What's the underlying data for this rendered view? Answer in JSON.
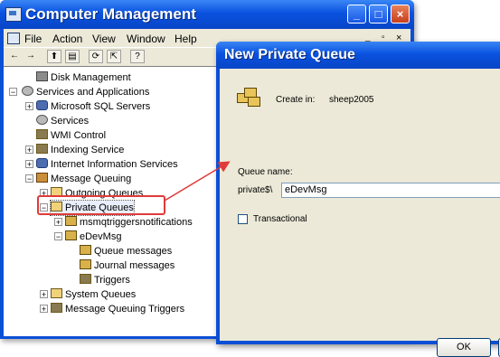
{
  "main_window": {
    "title": "Computer Management",
    "window_buttons": {
      "minimize": "_",
      "maximize": "□",
      "close": "×"
    },
    "menu": [
      "File",
      "Action",
      "View",
      "Window",
      "Help"
    ],
    "mdi_buttons": {
      "minimize": "_",
      "restore": "▫",
      "close": "×"
    },
    "toolbar_icons": [
      "back-icon",
      "forward-icon",
      "up-icon",
      "properties-icon",
      "refresh-icon",
      "export-icon",
      "help-icon"
    ],
    "toolbar_glyphs": {
      "back": "←",
      "forward": "→",
      "up": "⬆",
      "properties": "▤",
      "refresh": "⟳",
      "export": "⇱",
      "help": "?"
    },
    "tree": [
      {
        "label": "Disk Management",
        "icon": "disk-icon"
      },
      {
        "label": "Services and Applications",
        "icon": "gear-icon",
        "expander": "−"
      },
      {
        "label": "Microsoft SQL Servers",
        "icon": "database-icon",
        "expander": "+"
      },
      {
        "label": "Services",
        "icon": "services-icon"
      },
      {
        "label": "WMI Control",
        "icon": "wmi-icon"
      },
      {
        "label": "Indexing Service",
        "icon": "indexing-icon",
        "expander": "+"
      },
      {
        "label": "Internet Information Services",
        "icon": "iis-icon",
        "expander": "+"
      },
      {
        "label": "Message Queuing",
        "icon": "message-queuing-icon",
        "expander": "−"
      },
      {
        "label": "Outgoing Queues",
        "icon": "folder-icon",
        "expander": "+"
      },
      {
        "label": "Private Queues",
        "icon": "folder-icon",
        "expander": "−"
      },
      {
        "label": "msmqtriggersnotifications",
        "icon": "queue-icon",
        "expander": "+"
      },
      {
        "label": "eDevMsg",
        "icon": "queue-icon",
        "expander": "−"
      },
      {
        "label": "Queue messages",
        "icon": "messages-icon"
      },
      {
        "label": "Journal messages",
        "icon": "messages-icon"
      },
      {
        "label": "Triggers",
        "icon": "triggers-icon"
      },
      {
        "label": "System Queues",
        "icon": "folder-icon",
        "expander": "+"
      },
      {
        "label": "Message Queuing Triggers",
        "icon": "triggers-icon",
        "expander": "+"
      }
    ]
  },
  "dialog": {
    "title": "New Private Queue",
    "create_in_label": "Create in:",
    "create_in_value": "sheep2005",
    "queue_name_label": "Queue name:",
    "queue_prefix": "private$\\",
    "queue_name_value": "eDevMsg",
    "transactional_label": "Transactional",
    "transactional_checked": false,
    "ok_label": "OK"
  },
  "colors": {
    "titlebar": "#0a52e0",
    "face": "#ece9d8",
    "highlight": "#e03a3a"
  }
}
